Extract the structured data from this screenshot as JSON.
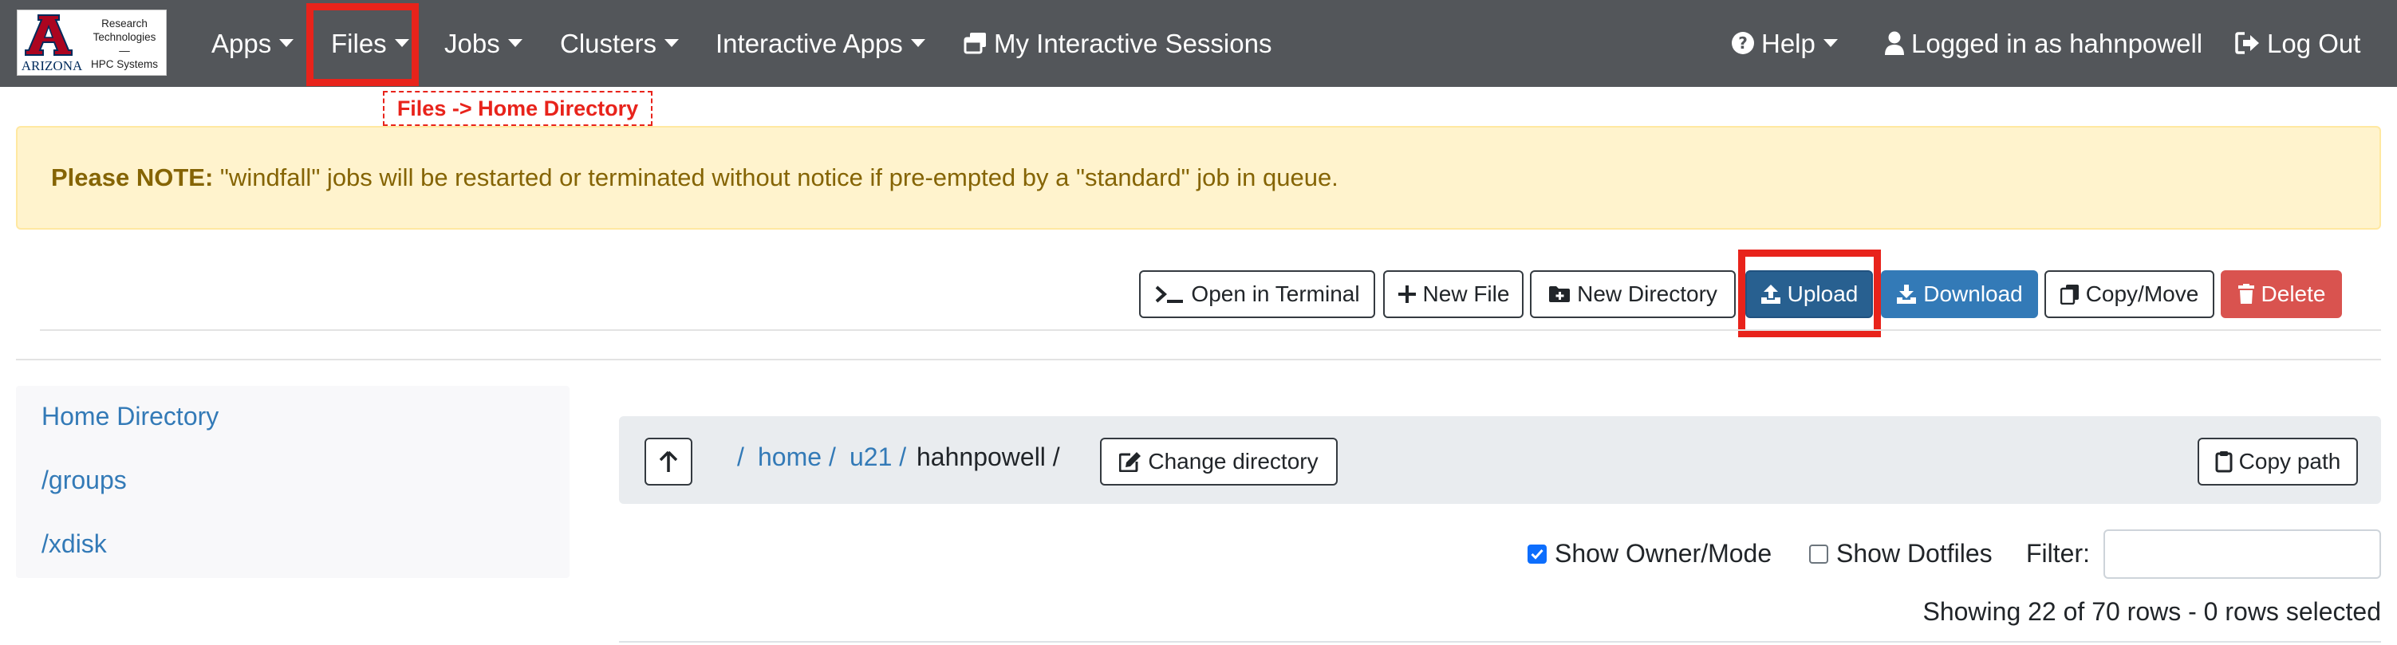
{
  "logo": {
    "word": "ARIZONA",
    "text_lines": [
      "Research",
      "Technologies",
      "—",
      "HPC Systems"
    ]
  },
  "nav": {
    "apps": "Apps",
    "files": "Files",
    "jobs": "Jobs",
    "clusters": "Clusters",
    "interactive_apps": "Interactive Apps",
    "my_sessions": "My Interactive Sessions",
    "help": "Help",
    "logged_in": "Logged in as hahnpowell",
    "logout": "Log Out"
  },
  "annotation": {
    "files_tag": "Files -> Home Directory",
    "highlight_color": "#e8231b"
  },
  "alert": {
    "label": "Please NOTE:",
    "message": " \"windfall\" jobs will be restarted or terminated without notice if pre-empted by a \"standard\" job in queue."
  },
  "toolbar": {
    "open_terminal": "Open in Terminal",
    "new_file": "New File",
    "new_directory": "New Directory",
    "upload": "Upload",
    "download": "Download",
    "copy_move": "Copy/Move",
    "delete": "Delete"
  },
  "sidebar": {
    "items": [
      "Home Directory",
      "/groups",
      "/xdisk"
    ]
  },
  "path": {
    "root": "/",
    "segments": [
      "home /",
      "u21 /"
    ],
    "current": "hahnpowell /",
    "change_directory": "Change directory",
    "copy_path": "Copy path"
  },
  "options": {
    "show_owner_mode": "Show Owner/Mode",
    "show_owner_mode_checked": true,
    "show_dotfiles": "Show Dotfiles",
    "show_dotfiles_checked": false,
    "filter_label": "Filter:",
    "filter_value": ""
  },
  "status": {
    "showing": "Showing 22 of 70 rows - 0 rows selected"
  },
  "colors": {
    "navbar": "#53565a",
    "link": "#337ab7",
    "upload": "#286090",
    "download": "#337ab7",
    "delete": "#d9534f",
    "alert_bg": "#fff3cd",
    "alert_text": "#856404"
  },
  "icons": {
    "help": "question-circle-icon",
    "user": "user-icon",
    "logout": "sign-out-icon",
    "sessions": "windows-icon",
    "terminal": "terminal-icon",
    "new_file": "plus-icon",
    "new_directory": "folder-plus-icon",
    "upload": "upload-icon",
    "download": "download-icon",
    "copy": "copy-icon",
    "delete": "trash-icon",
    "up": "arrow-up-icon",
    "edit": "edit-icon",
    "clipboard": "clipboard-icon"
  }
}
